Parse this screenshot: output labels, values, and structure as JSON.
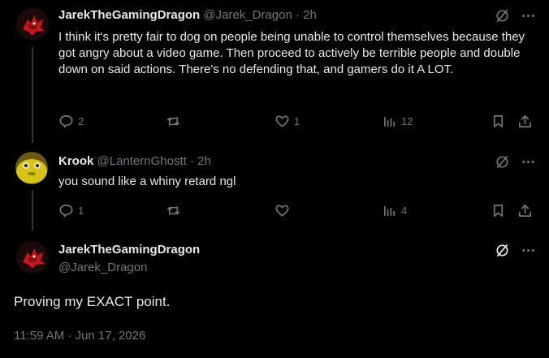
{
  "posts": [
    {
      "name": "JarekTheGamingDragon",
      "handle": "@Jarek_Dragon",
      "time": "2h",
      "text": "I think it's pretty fair to dog on people being unable to control themselves because they got angry about a video game. Then proceed to actively be terrible people and double down on said actions. There's no defending that, and gamers do it A LOT.",
      "replies": "2",
      "reposts": "",
      "likes": "1",
      "views": "12",
      "avatar": "red-dragon-avatar"
    },
    {
      "name": "Krook",
      "handle": "@LanternGhostt",
      "time": "2h",
      "text": "you sound like a whiny retard ngl",
      "replies": "1",
      "reposts": "",
      "likes": "",
      "views": "4",
      "avatar": "yellow-creature-avatar"
    }
  ],
  "main_post": {
    "name": "JarekTheGamingDragon",
    "handle": "@Jarek_Dragon",
    "text": "Proving my EXACT point.",
    "timestamp": "11:59 AM · Jun 17, 2026"
  },
  "separator": " · ",
  "icons": [
    "grok-icon",
    "more-icon",
    "reply-icon",
    "repost-icon",
    "like-icon",
    "views-icon",
    "bookmark-icon",
    "share-icon"
  ],
  "colors": {
    "background": "#000000",
    "text": "#e7e9ea",
    "muted": "#71767b",
    "thread_line": "#333639"
  }
}
